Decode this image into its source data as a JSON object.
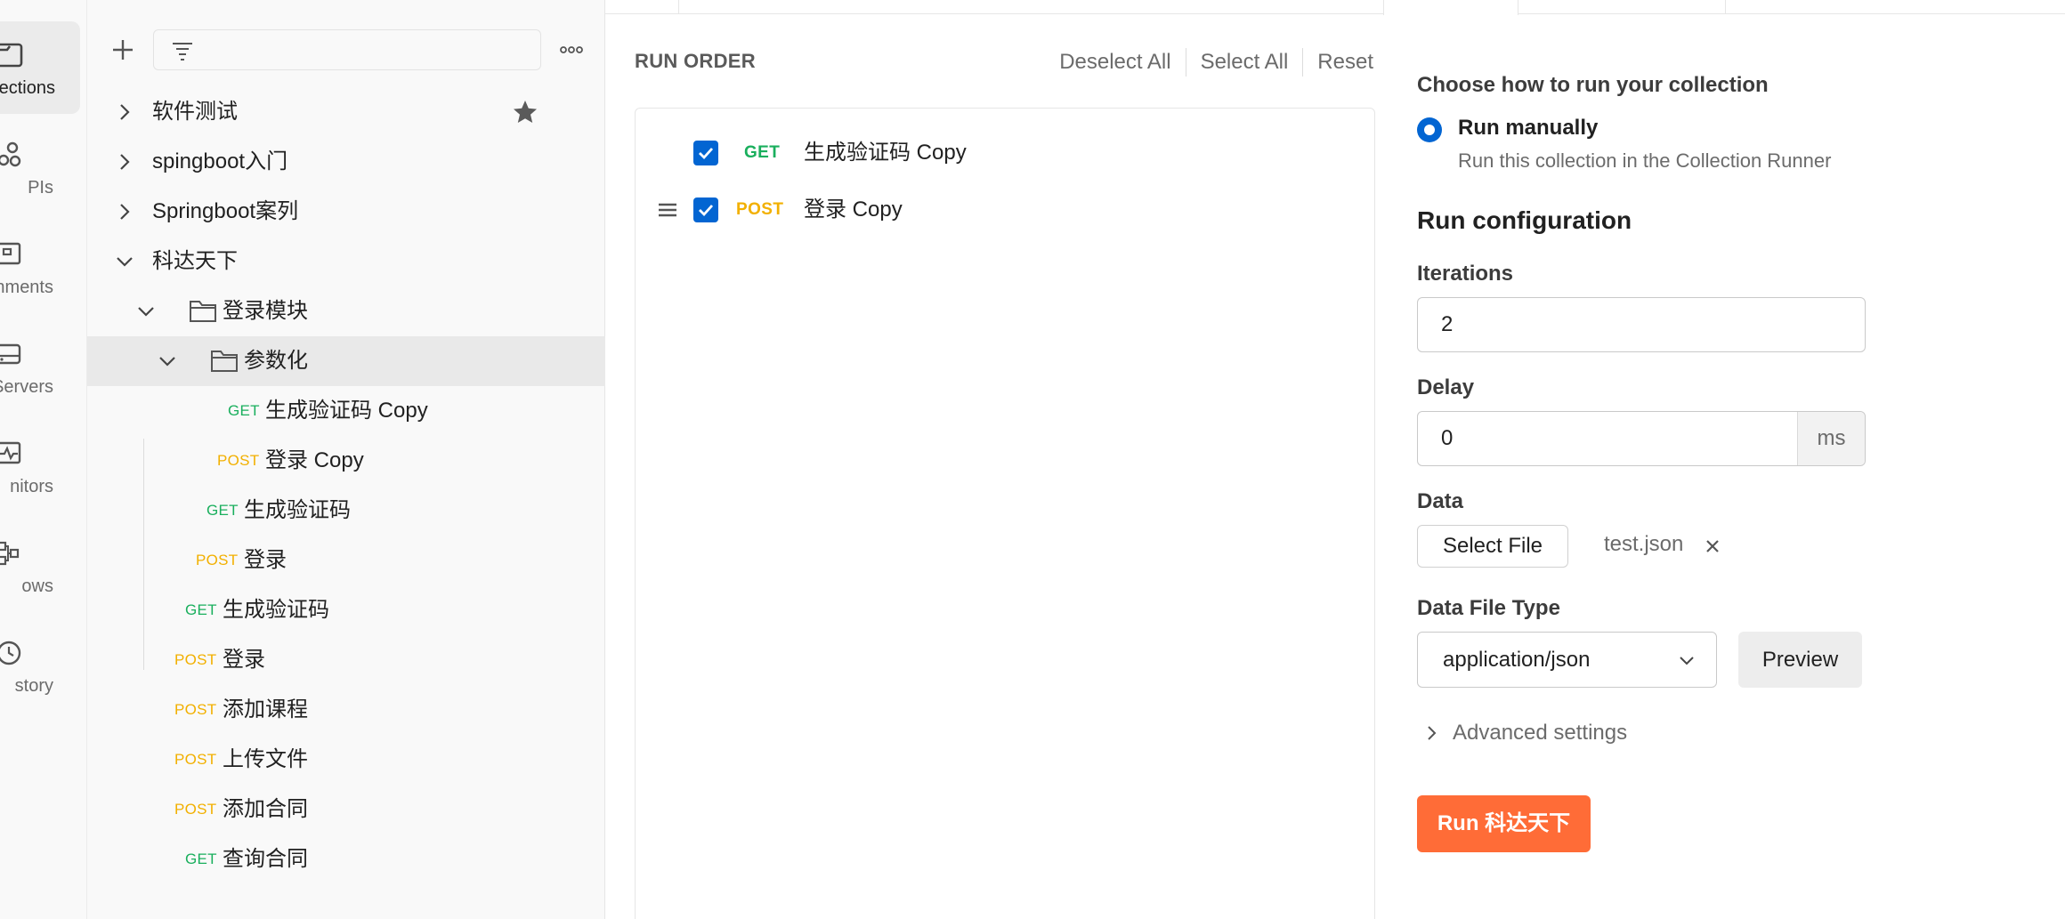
{
  "rail": {
    "items": [
      {
        "label": "ections",
        "icon": "collections-icon",
        "active": true
      },
      {
        "label": "PIs",
        "icon": "apis-icon"
      },
      {
        "label": "onments",
        "icon": "environments-icon"
      },
      {
        "label": "Servers",
        "icon": "mock-servers-icon"
      },
      {
        "label": "nitors",
        "icon": "monitors-icon"
      },
      {
        "label": "ows",
        "icon": "flows-icon"
      },
      {
        "label": "story",
        "icon": "history-icon"
      }
    ]
  },
  "sidebar": {
    "tree": [
      {
        "label": "软件测试"
      },
      {
        "label": "spingboot入门"
      },
      {
        "label": "Springboot案列"
      },
      {
        "label": "科达天下"
      },
      {
        "label": "登录模块"
      },
      {
        "label": "参数化"
      },
      {
        "method": "GET",
        "label": "生成验证码 Copy"
      },
      {
        "method": "POST",
        "label": "登录 Copy"
      },
      {
        "method": "GET",
        "label": "生成验证码"
      },
      {
        "method": "POST",
        "label": "登录"
      },
      {
        "method": "GET",
        "label": "生成验证码"
      },
      {
        "method": "POST",
        "label": "登录"
      },
      {
        "method": "POST",
        "label": "添加课程"
      },
      {
        "method": "POST",
        "label": "上传文件"
      },
      {
        "method": "POST",
        "label": "添加合同"
      },
      {
        "method": "GET",
        "label": "查询合同"
      }
    ]
  },
  "run_order": {
    "title": "RUN ORDER",
    "deselect_all": "Deselect All",
    "select_all": "Select All",
    "reset": "Reset",
    "items": [
      {
        "method": "GET",
        "name": "生成验证码 Copy",
        "checked": true
      },
      {
        "method": "POST",
        "name": "登录 Copy",
        "checked": true
      }
    ]
  },
  "config": {
    "choose_heading": "Choose how to run your collection",
    "run_manually": "Run manually",
    "run_manually_desc": "Run this collection in the Collection Runner",
    "run_config_heading": "Run configuration",
    "iterations_label": "Iterations",
    "iterations_value": "2",
    "delay_label": "Delay",
    "delay_value": "0",
    "delay_unit": "ms",
    "data_label": "Data",
    "select_file": "Select File",
    "file_name": "test.json",
    "data_file_type_label": "Data File Type",
    "data_file_type_value": "application/json",
    "preview": "Preview",
    "advanced_settings": "Advanced settings",
    "run_button": "Run 科达天下"
  },
  "colors": {
    "get": "#1aaf5d",
    "post": "#f2b000",
    "accent_blue": "#0265d2",
    "run_orange": "#ff6c37"
  }
}
